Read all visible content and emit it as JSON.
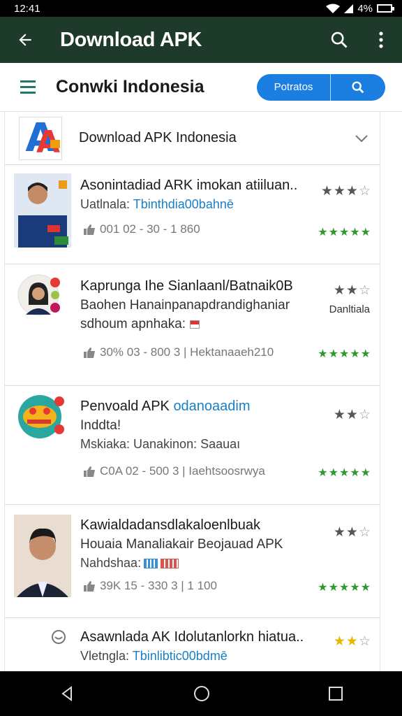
{
  "status_bar": {
    "time": "12:41",
    "battery_text": "4%"
  },
  "app_bar": {
    "title": "Download APK"
  },
  "toolbar": {
    "title": "Conwki Indonesia",
    "pill_label": "Potratos"
  },
  "header_card": {
    "title": "Download APK Indonesia"
  },
  "rows": [
    {
      "line1": "Asonintadiad ARK imokan atiiluan..",
      "sub_prefix": "Uatlnala:",
      "sub_link": "Tbinthdia00bahnē",
      "stats": "001 02 - 30 - 1 860"
    },
    {
      "line1": "Kaprunga Ihe Sianlaanl/Batnaik0B",
      "line2": "Baohen Hanainpanapdrandighaniar",
      "line3": "sdhoum apnhaka:",
      "side_label": "Danltiala",
      "stats": "30% 03 - 800 3  |  Hektanaaeh210"
    },
    {
      "line1": "Penvoald APK",
      "line1_link": "odanoaadim",
      "line2": "Inddta!",
      "sub_prefix": "Mskiaka: Uanakinon: Saauaı",
      "stats": "C0A 02 - 500 3  |  Iaehtsoosrwya"
    },
    {
      "line1": "Kawialdadansdlakaloenlbuak",
      "line2": "Houaia Manaliakair Beojauad APK",
      "sub_prefix": "Nahdshaa:",
      "stats": "39K 15 - 330  3  | 1 100"
    },
    {
      "line1": "Asawnlada AK Idolutanlorkn hiatua..",
      "sub_prefix": "Vletngla:",
      "sub_link": "Tbinlibtic00bdmē"
    }
  ],
  "colors": {
    "appbar": "#1d3a2b",
    "accent": "#1a7fe0",
    "star_green": "#2e9a2e",
    "link": "#1a7fc4"
  },
  "icons": [
    "back-arrow-icon",
    "search-icon",
    "more-vert-icon",
    "menu-icon",
    "chevron-down-icon",
    "thumbs-up-icon",
    "back-nav-icon",
    "home-nav-icon",
    "recents-nav-icon"
  ]
}
